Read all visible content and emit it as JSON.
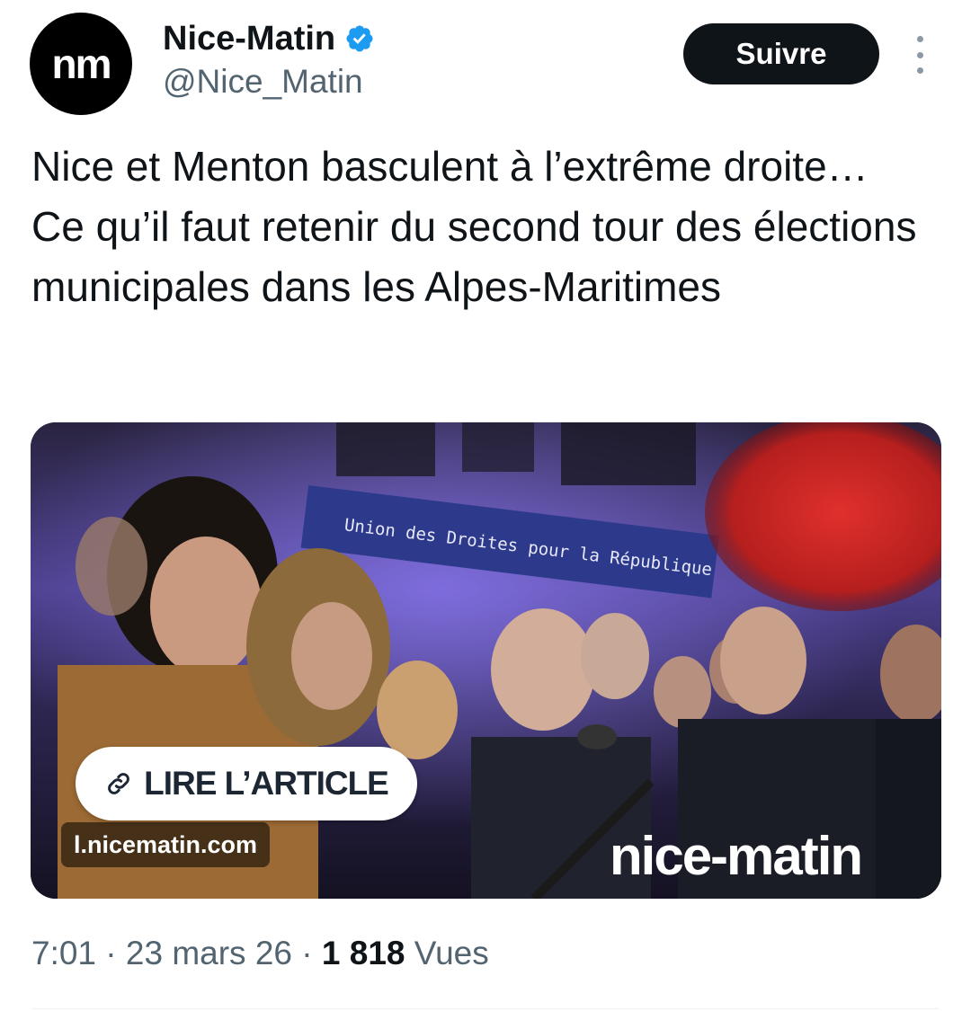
{
  "author": {
    "avatar_text": "nm",
    "display_name": "Nice-Matin",
    "handle": "@Nice_Matin",
    "verified_icon": "verified-badge-icon",
    "verified_color": "#1d9bf0"
  },
  "actions": {
    "follow_label": "Suivre",
    "more_icon": "more-vertical-icon"
  },
  "tweet": {
    "text": "Nice et Menton basculent à l’extrême droite… Ce qu’il faut retenir du second tour des élections municipales dans les Alpes-Maritimes"
  },
  "card": {
    "banner_text": "Union des Droites pour la République",
    "cta_icon": "link-icon",
    "cta_label": "LIRE L’ARTICLE",
    "domain": "l.nicematin.com",
    "brand_watermark": "nice-matin"
  },
  "meta": {
    "time": "7:01",
    "separator": "·",
    "date": "23 mars 26",
    "views_count": "1 818",
    "views_label": "Vues"
  },
  "colors": {
    "text_primary": "#0f1419",
    "text_secondary": "#536471",
    "button_bg": "#0f1419"
  }
}
